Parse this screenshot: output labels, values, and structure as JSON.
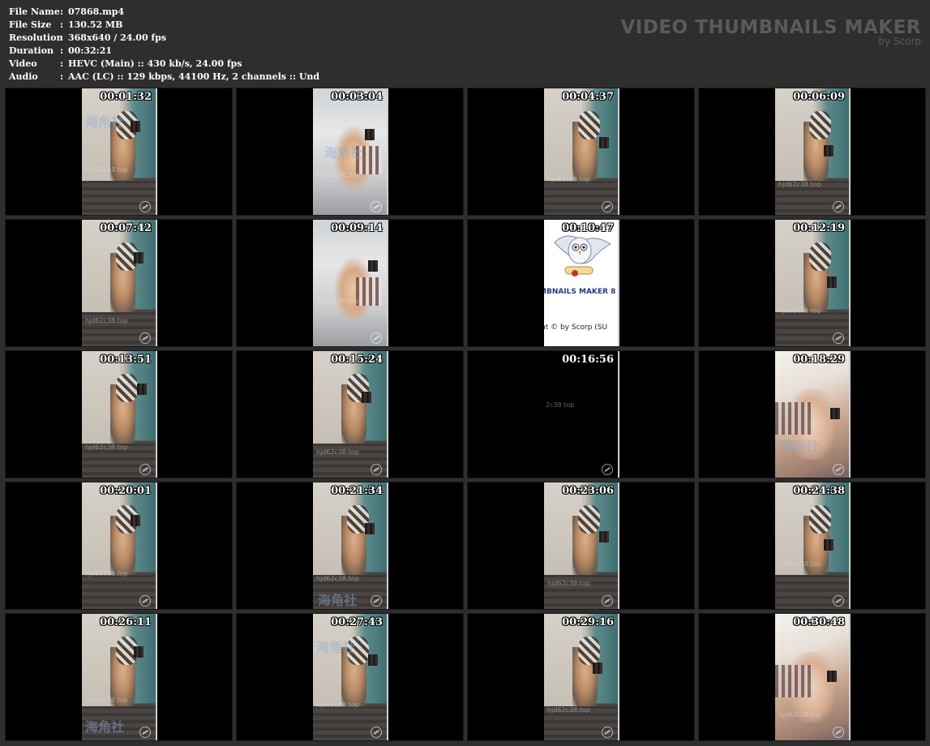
{
  "info": {
    "rows": [
      {
        "key": "File Name",
        "value": "07868.mp4"
      },
      {
        "key": "File Size",
        "value": "130.52 MB"
      },
      {
        "key": "Resolution",
        "value": "368x640 / 24.00 fps"
      },
      {
        "key": "Duration",
        "value": "00:32:21"
      },
      {
        "key": "Video",
        "value": "HEVC (Main) :: 430 kb/s, 24.00 fps"
      },
      {
        "key": "Audio",
        "value": "AAC (LC) :: 129 kbps, 44100 Hz, 2 channels :: Und"
      }
    ],
    "separator": ":"
  },
  "brand": {
    "title": "VIDEO THUMBNAILS MAKER",
    "subtitle": "by Scorp"
  },
  "logo_frame": {
    "line1": "MBNAILS MAKER 8",
    "line2": "nt © by Scorp (SU"
  },
  "thumbnails": [
    {
      "timestamp": "00:01:32",
      "scene": "room"
    },
    {
      "timestamp": "00:03:04",
      "scene": "bed"
    },
    {
      "timestamp": "00:04:37",
      "scene": "room"
    },
    {
      "timestamp": "00:06:09",
      "scene": "room"
    },
    {
      "timestamp": "00:07:42",
      "scene": "room"
    },
    {
      "timestamp": "00:09:14",
      "scene": "bed"
    },
    {
      "timestamp": "00:10:47",
      "scene": "logo"
    },
    {
      "timestamp": "00:12:19",
      "scene": "room"
    },
    {
      "timestamp": "00:13:51",
      "scene": "room"
    },
    {
      "timestamp": "00:15:24",
      "scene": "room"
    },
    {
      "timestamp": "00:16:56",
      "scene": "black"
    },
    {
      "timestamp": "00:18:29",
      "scene": "closeup"
    },
    {
      "timestamp": "00:20:01",
      "scene": "room"
    },
    {
      "timestamp": "00:21:34",
      "scene": "room"
    },
    {
      "timestamp": "00:23:06",
      "scene": "room"
    },
    {
      "timestamp": "00:24:38",
      "scene": "room"
    },
    {
      "timestamp": "00:26:11",
      "scene": "room"
    },
    {
      "timestamp": "00:27:43",
      "scene": "room"
    },
    {
      "timestamp": "00:29:16",
      "scene": "room"
    },
    {
      "timestamp": "00:30:48",
      "scene": "closeup"
    }
  ],
  "watermarks": {
    "cjk": "海角社",
    "site": "hjd62c38.top",
    "site_short": "2c38 top"
  },
  "colors": {
    "background": "#2e2e2e",
    "cell": "#000000",
    "brand": "#5a5a5a",
    "text": "#ffffff"
  }
}
